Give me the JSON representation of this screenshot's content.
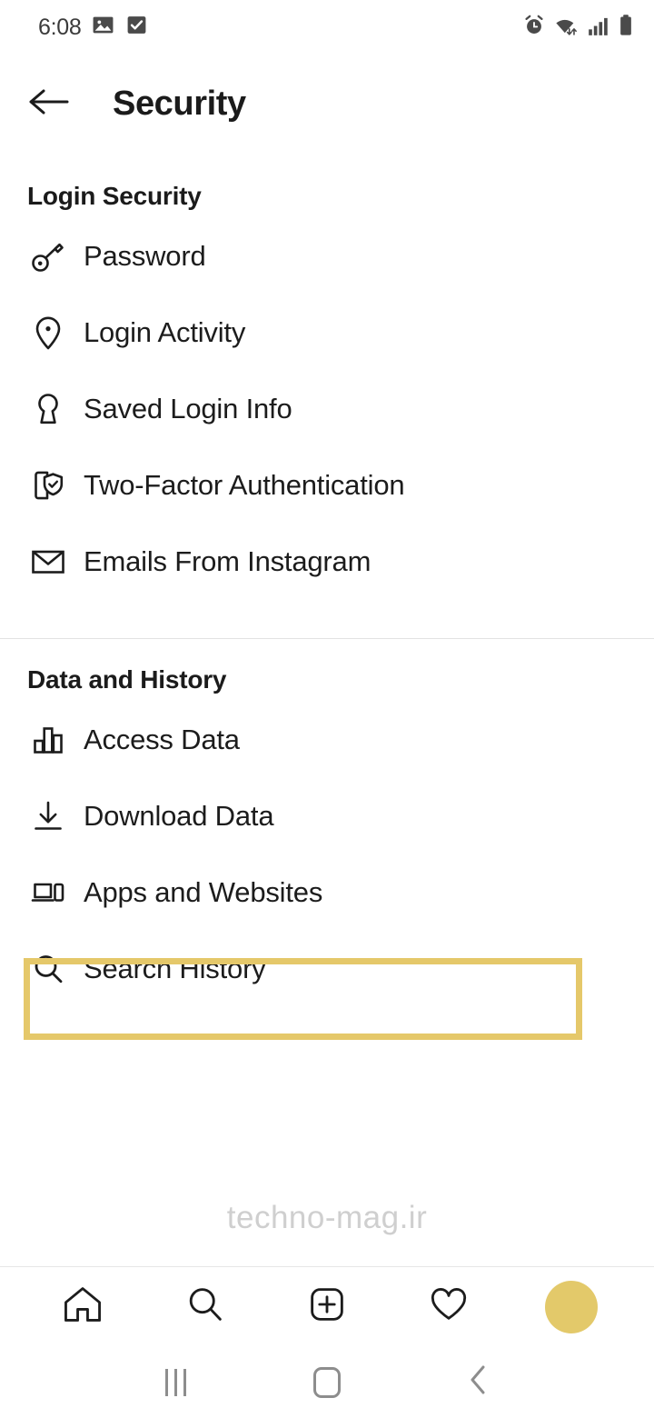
{
  "status_bar": {
    "time": "6:08",
    "left_icons": [
      "photo-icon",
      "checkbox-checked-icon"
    ],
    "right_icons": [
      "alarm-icon",
      "wifi-icon",
      "cellular-signal-icon",
      "battery-icon"
    ]
  },
  "header": {
    "back_icon": "back-arrow-icon",
    "title": "Security"
  },
  "sections": [
    {
      "id": "login",
      "title": "Login Security",
      "items": [
        {
          "label": "Password",
          "icon": "key-icon"
        },
        {
          "label": "Login Activity",
          "icon": "location-pin-icon"
        },
        {
          "label": "Saved Login Info",
          "icon": "keyhole-icon"
        },
        {
          "label": "Two-Factor Authentication",
          "icon": "device-shield-check-icon"
        },
        {
          "label": "Emails From Instagram",
          "icon": "envelope-icon"
        }
      ]
    },
    {
      "id": "data",
      "title": "Data and History",
      "items": [
        {
          "label": "Access Data",
          "icon": "bar-chart-icon"
        },
        {
          "label": "Download Data",
          "icon": "download-arrow-icon"
        },
        {
          "label": "Apps and Websites",
          "icon": "laptop-phone-icon"
        },
        {
          "label": "Search History",
          "icon": "magnifier-icon"
        }
      ]
    }
  ],
  "highlight": {
    "target_label": "Search History",
    "color": "#e5c86a"
  },
  "watermark": {
    "text": "techno-mag.ir"
  },
  "bottom_nav": {
    "items": [
      {
        "name": "home",
        "icon": "home-icon"
      },
      {
        "name": "search",
        "icon": "magnifier-icon"
      },
      {
        "name": "create",
        "icon": "plus-square-icon"
      },
      {
        "name": "activity",
        "icon": "heart-icon"
      },
      {
        "name": "profile",
        "icon": "avatar-icon"
      }
    ],
    "avatar_color": "#e3c96a"
  },
  "system_nav": {
    "items": [
      {
        "name": "recents",
        "icon": "recents-bars-icon"
      },
      {
        "name": "home",
        "icon": "home-circle-icon"
      },
      {
        "name": "back",
        "icon": "chevron-left-icon"
      }
    ]
  }
}
